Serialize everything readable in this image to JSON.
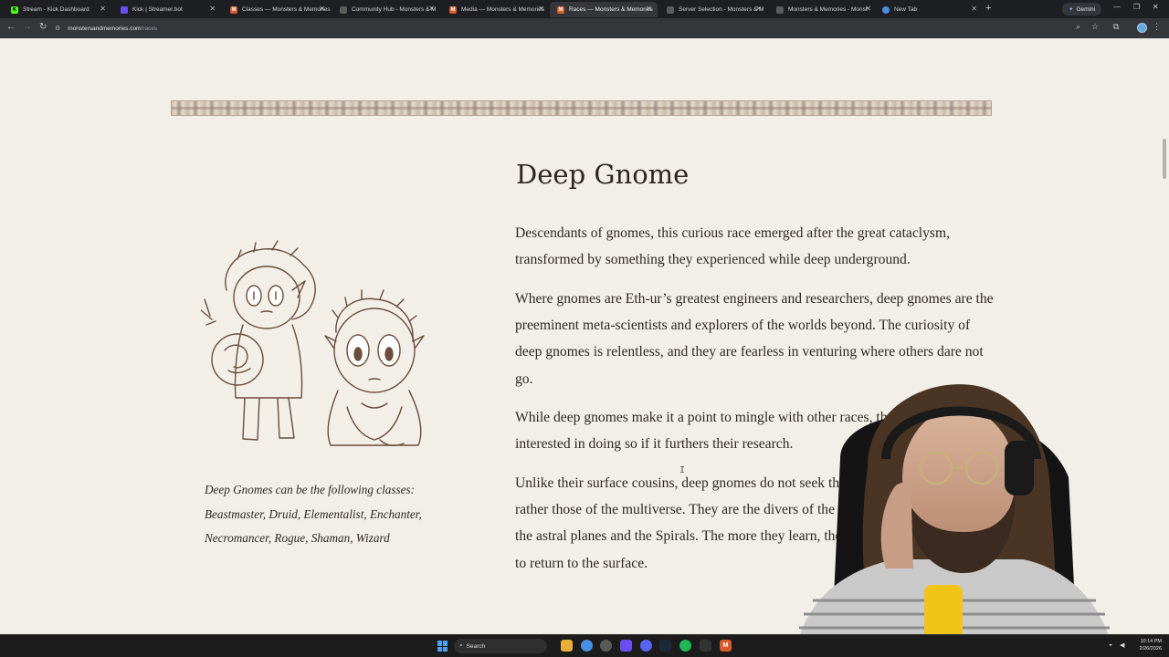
{
  "browser": {
    "tabs": [
      {
        "label": "Stream - Kick Dashboard",
        "icon": "kick-icon",
        "color": "#53fc18",
        "glyph": "K",
        "active": false
      },
      {
        "label": "Kick | Streamer.bot",
        "icon": "streamerbot-icon",
        "color": "#6b4ef0",
        "glyph": "",
        "active": false
      },
      {
        "label": "Classes — Monsters & Memories",
        "icon": "mnm-icon",
        "color": "#d95a2b",
        "glyph": "M",
        "active": false
      },
      {
        "label": "Community Hub - Monsters & M",
        "icon": "page-icon",
        "color": "#5b5b5b",
        "glyph": "",
        "active": false
      },
      {
        "label": "Media — Monsters & Memories",
        "icon": "mnm-icon",
        "color": "#d95a2b",
        "glyph": "M",
        "active": false
      },
      {
        "label": "Races — Monsters & Memories",
        "icon": "mnm-icon",
        "color": "#d95a2b",
        "glyph": "M",
        "active": true
      },
      {
        "label": "Server Selection - Monsters & M",
        "icon": "page-icon",
        "color": "#5b5b5b",
        "glyph": "",
        "active": false
      },
      {
        "label": "Monsters & Memories - Monst",
        "icon": "page-icon",
        "color": "#5b5b5b",
        "glyph": "",
        "active": false
      },
      {
        "label": "New Tab",
        "icon": "chrome-icon",
        "color": "#4a90e2",
        "glyph": "",
        "active": false
      }
    ],
    "gemini_label": "Gemini",
    "url_host": "monstersandmemories.com",
    "url_path": "/races"
  },
  "race": {
    "title": "Deep Gnome",
    "paragraphs": [
      "Descendants of gnomes, this curious race emerged after the great cataclysm, transformed by something they experienced while deep underground.",
      "Where gnomes are Eth-ur’s greatest engineers and researchers, deep gnomes are the preeminent meta-scientists and explorers of the worlds beyond. The curiosity of deep gnomes is relentless, and they are fearless in venturing where others dare not go.",
      "While deep gnomes make it a point to mingle with other races, they are only interested in doing so if it furthers their research.",
      "Unlike their surface cousins, deep gnomes do not seek the truths of the universe, but rather those of the multiverse. They are the divers of the dreamscapes, explorers of the astral planes and the Spirals. The more they learn, the more pressing their desire to return to the surface."
    ],
    "classes_note": "Deep Gnomes can be the following classes: Beastmaster, Druid, Elementalist, Enchanter, Necromancer, Rogue, Shaman, Wizard"
  },
  "taskbar": {
    "search_label": "Search",
    "time": "10:14 PM",
    "date": "2/26/2026"
  },
  "colors": {
    "page_bg": "#f2efe8",
    "text": "#2e2924",
    "accent_orange": "#d95a2b"
  }
}
